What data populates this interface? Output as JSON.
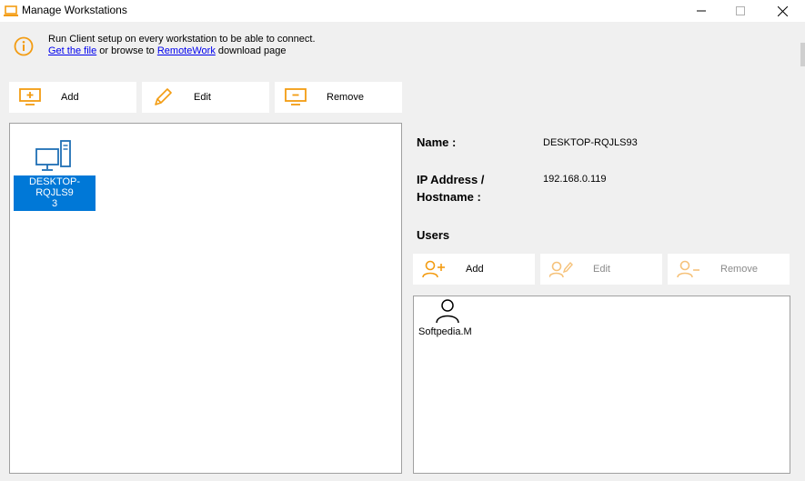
{
  "window": {
    "title": "Manage Workstations",
    "minimize_icon": "minimize-icon",
    "maximize_icon": "maximize-icon",
    "close_icon": "close-icon"
  },
  "info": {
    "message": "Run Client setup on every workstation to be able to connect.",
    "get_file_link": "Get the file",
    "or_browse": " or browse to ",
    "remotework_link": "RemoteWork",
    "download_page": " download page"
  },
  "toolbar": {
    "add_label": "Add",
    "edit_label": "Edit",
    "remove_label": "Remove"
  },
  "workstations": [
    {
      "label_line1": "DESKTOP-RQJLS9",
      "label_line2": "3"
    }
  ],
  "details": {
    "name_label": "Name :",
    "name_value": "DESKTOP-RQJLS93",
    "ip_label_line1": "IP Address /",
    "ip_label_line2": "Hostname :",
    "ip_value": "192.168.0.119",
    "users_heading": "Users"
  },
  "users_toolbar": {
    "add_label": "Add",
    "edit_label": "Edit",
    "remove_label": "Remove",
    "edit_enabled": false,
    "remove_enabled": false
  },
  "users": [
    {
      "name": "Softpedia.M"
    }
  ],
  "colors": {
    "accent_orange": "#f39c12",
    "selection_blue": "#0078d7",
    "icon_blue": "#1f6fb5",
    "disabled_gray": "#8a8a8a"
  }
}
